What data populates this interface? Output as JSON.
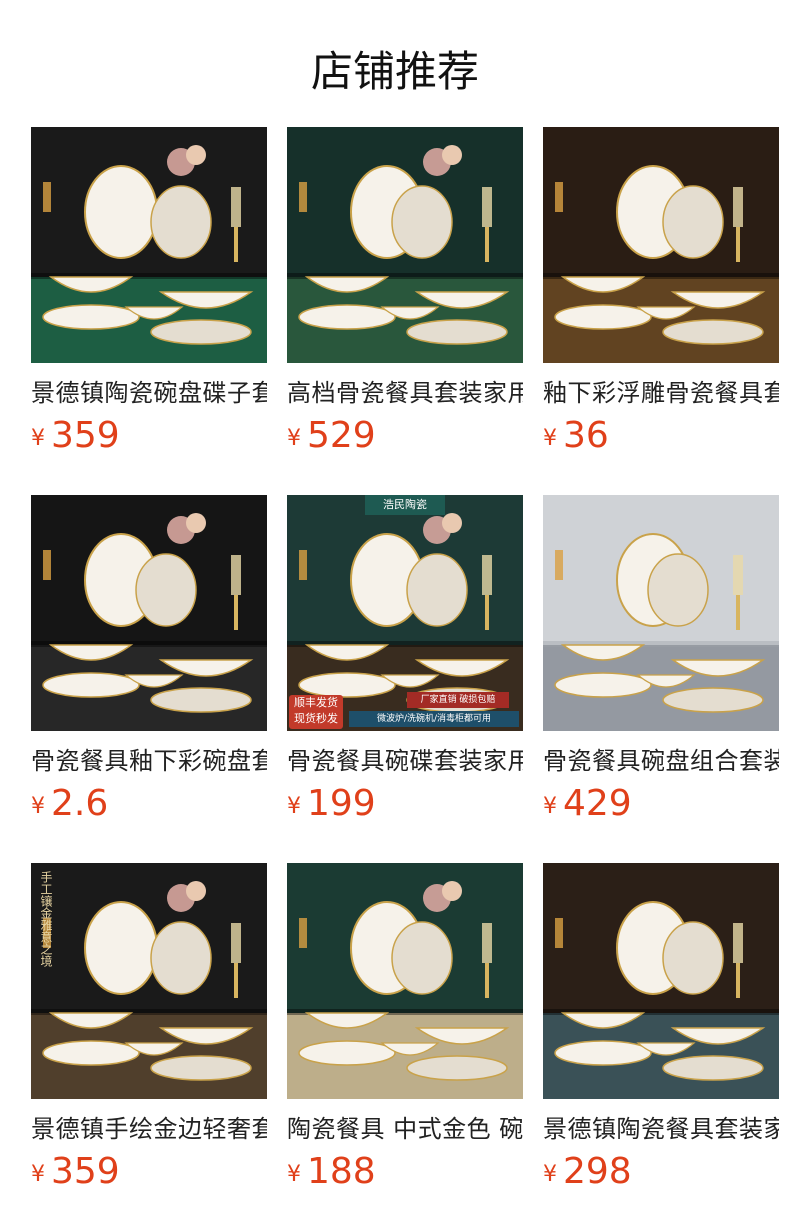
{
  "header": {
    "title": "店铺推荐"
  },
  "currency": "¥",
  "products": [
    {
      "name": "景德镇陶瓷碗盘碟子套装",
      "price": "359",
      "image": "tableware-photo",
      "bg": "#1a1a1a",
      "accent": "#1f6b4b"
    },
    {
      "name": "高档骨瓷餐具套装家用",
      "price": "529",
      "image": "tableware-photo",
      "bg": "#16302a",
      "accent": "#2d5e3f"
    },
    {
      "name": "釉下彩浮雕骨瓷餐具套装",
      "price": "36",
      "image": "tableware-photo",
      "bg": "#2a1d14",
      "accent": "#6b4a23"
    },
    {
      "name": "骨瓷餐具釉下彩碗盘套装",
      "price": "2.6",
      "image": "tableware-photo",
      "bg": "#151515",
      "accent": "#2a2a2a"
    },
    {
      "name": "骨瓷餐具碗碟套装家用",
      "price": "199",
      "image": "tableware-photo",
      "bg": "#1d3a36",
      "accent": "#3e2a1b",
      "badges": {
        "shop": "浩民陶瓷",
        "promo1": "顺丰发货",
        "promo2": "现货秒发",
        "line1": "厂家直销 破损包赔",
        "line2": "微波炉/洗碗机/消毒柜都可用"
      }
    },
    {
      "name": "骨瓷餐具碗盘组合套装",
      "price": "429",
      "image": "tableware-photo",
      "bg": "#cfd2d6",
      "accent": "#8a8f98"
    },
    {
      "name": "景德镇手绘金边轻奢套装",
      "price": "359",
      "image": "tableware-photo",
      "bg": "#1a1a1a",
      "accent": "#5a4630",
      "badges": {
        "v1": "手工镶金",
        "v2": "雅意之境"
      }
    },
    {
      "name": "陶瓷餐具 中式金色 碗碟",
      "price": "188",
      "image": "tableware-photo",
      "bg": "#1b3b33",
      "accent": "#d9c39a"
    },
    {
      "name": "景德镇陶瓷餐具套装家用",
      "price": "298",
      "image": "tableware-photo",
      "bg": "#2b1f17",
      "accent": "#3d5b63"
    }
  ]
}
